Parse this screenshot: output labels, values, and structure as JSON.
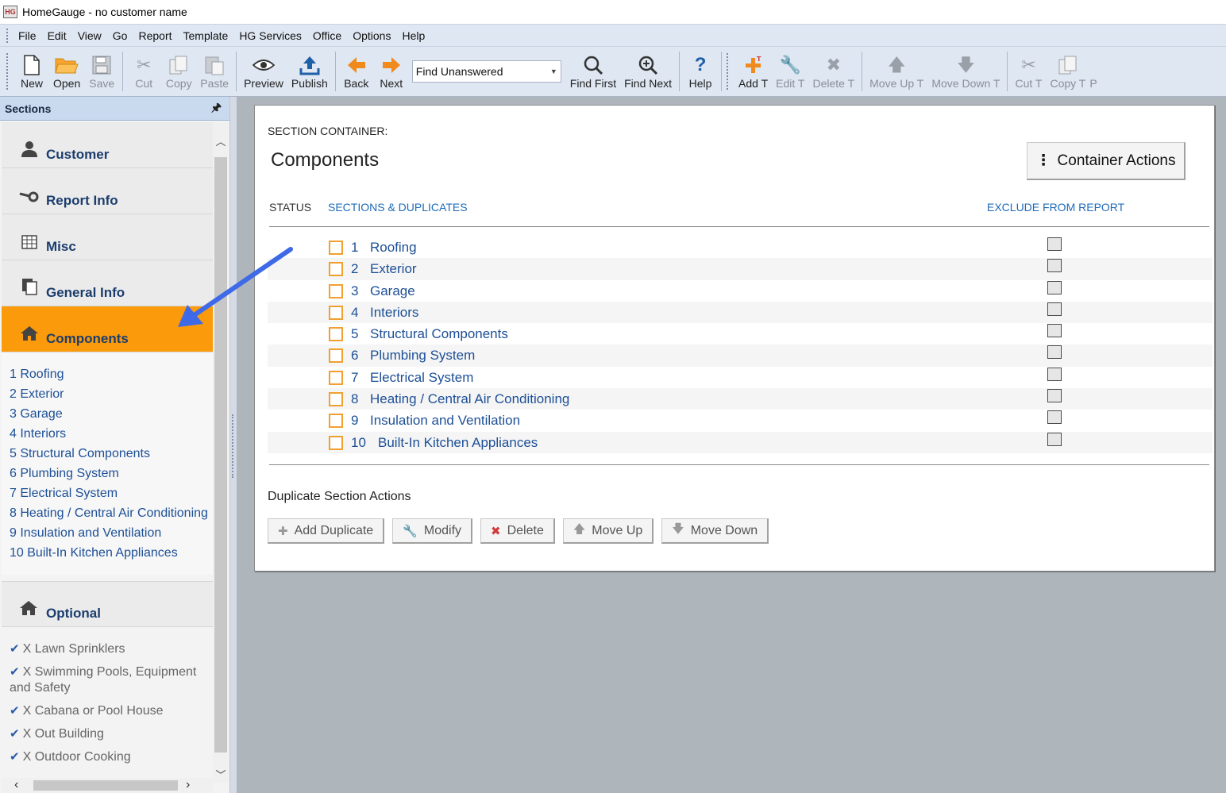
{
  "window": {
    "title": "HomeGauge - no customer name",
    "app_icon_text": "HG"
  },
  "menu": [
    "File",
    "Edit",
    "View",
    "Go",
    "Report",
    "Template",
    "HG Services",
    "Office",
    "Options",
    "Help"
  ],
  "toolbar": {
    "new": "New",
    "open": "Open",
    "save": "Save",
    "cut": "Cut",
    "copy": "Copy",
    "paste": "Paste",
    "preview": "Preview",
    "publish": "Publish",
    "back": "Back",
    "next": "Next",
    "find_select": "Find Unanswered",
    "find_first": "Find First",
    "find_next": "Find Next",
    "help": "Help",
    "add_t": "Add T",
    "edit_t": "Edit T",
    "delete_t": "Delete T",
    "move_up_t": "Move Up T",
    "move_down_t": "Move Down T",
    "cut_t": "Cut T",
    "copy_t": "Copy T",
    "overflow": "P"
  },
  "sidebar": {
    "header": "Sections",
    "nav": [
      {
        "label": "Customer",
        "icon": "person-icon"
      },
      {
        "label": "Report Info",
        "icon": "key-icon"
      },
      {
        "label": "Misc",
        "icon": "grid-icon"
      },
      {
        "label": "General Info",
        "icon": "documents-icon"
      },
      {
        "label": "Components",
        "icon": "house-icon"
      }
    ],
    "components": [
      "1 Roofing",
      "2 Exterior",
      "3 Garage",
      "4 Interiors",
      "5 Structural Components",
      "6 Plumbing System",
      "7 Electrical System",
      "8 Heating / Central Air Conditioning",
      "9 Insulation and Ventilation",
      "10 Built-In Kitchen Appliances"
    ],
    "optional_header": "Optional",
    "optional": [
      "X Lawn Sprinklers",
      "X Swimming Pools, Equipment and Safety",
      "X Cabana or Pool House",
      "X Out Building",
      "X Outdoor Cooking"
    ]
  },
  "main": {
    "section_label": "SECTION CONTAINER:",
    "title": "Components",
    "container_actions": "Container Actions",
    "col_status": "STATUS",
    "col_sections": "SECTIONS & DUPLICATES",
    "col_exclude": "EXCLUDE FROM REPORT",
    "rows": [
      {
        "num": "1",
        "name": "Roofing"
      },
      {
        "num": "2",
        "name": "Exterior"
      },
      {
        "num": "3",
        "name": "Garage"
      },
      {
        "num": "4",
        "name": "Interiors"
      },
      {
        "num": "5",
        "name": "Structural Components"
      },
      {
        "num": "6",
        "name": "Plumbing System"
      },
      {
        "num": "7",
        "name": "Electrical System"
      },
      {
        "num": "8",
        "name": "Heating / Central Air Conditioning"
      },
      {
        "num": "9",
        "name": "Insulation and Ventilation"
      },
      {
        "num": "10",
        "name": "Built-In Kitchen Appliances"
      }
    ],
    "dup_label": "Duplicate Section Actions",
    "dup_buttons": {
      "add": "Add Duplicate",
      "modify": "Modify",
      "delete": "Delete",
      "move_up": "Move Up",
      "move_down": "Move Down"
    }
  },
  "colors": {
    "active_nav": "#fb9a0a",
    "link": "#1d4f96",
    "header_link": "#1d6bb8",
    "arrow": "#3e6ae8",
    "status_box": "#f0a030"
  }
}
